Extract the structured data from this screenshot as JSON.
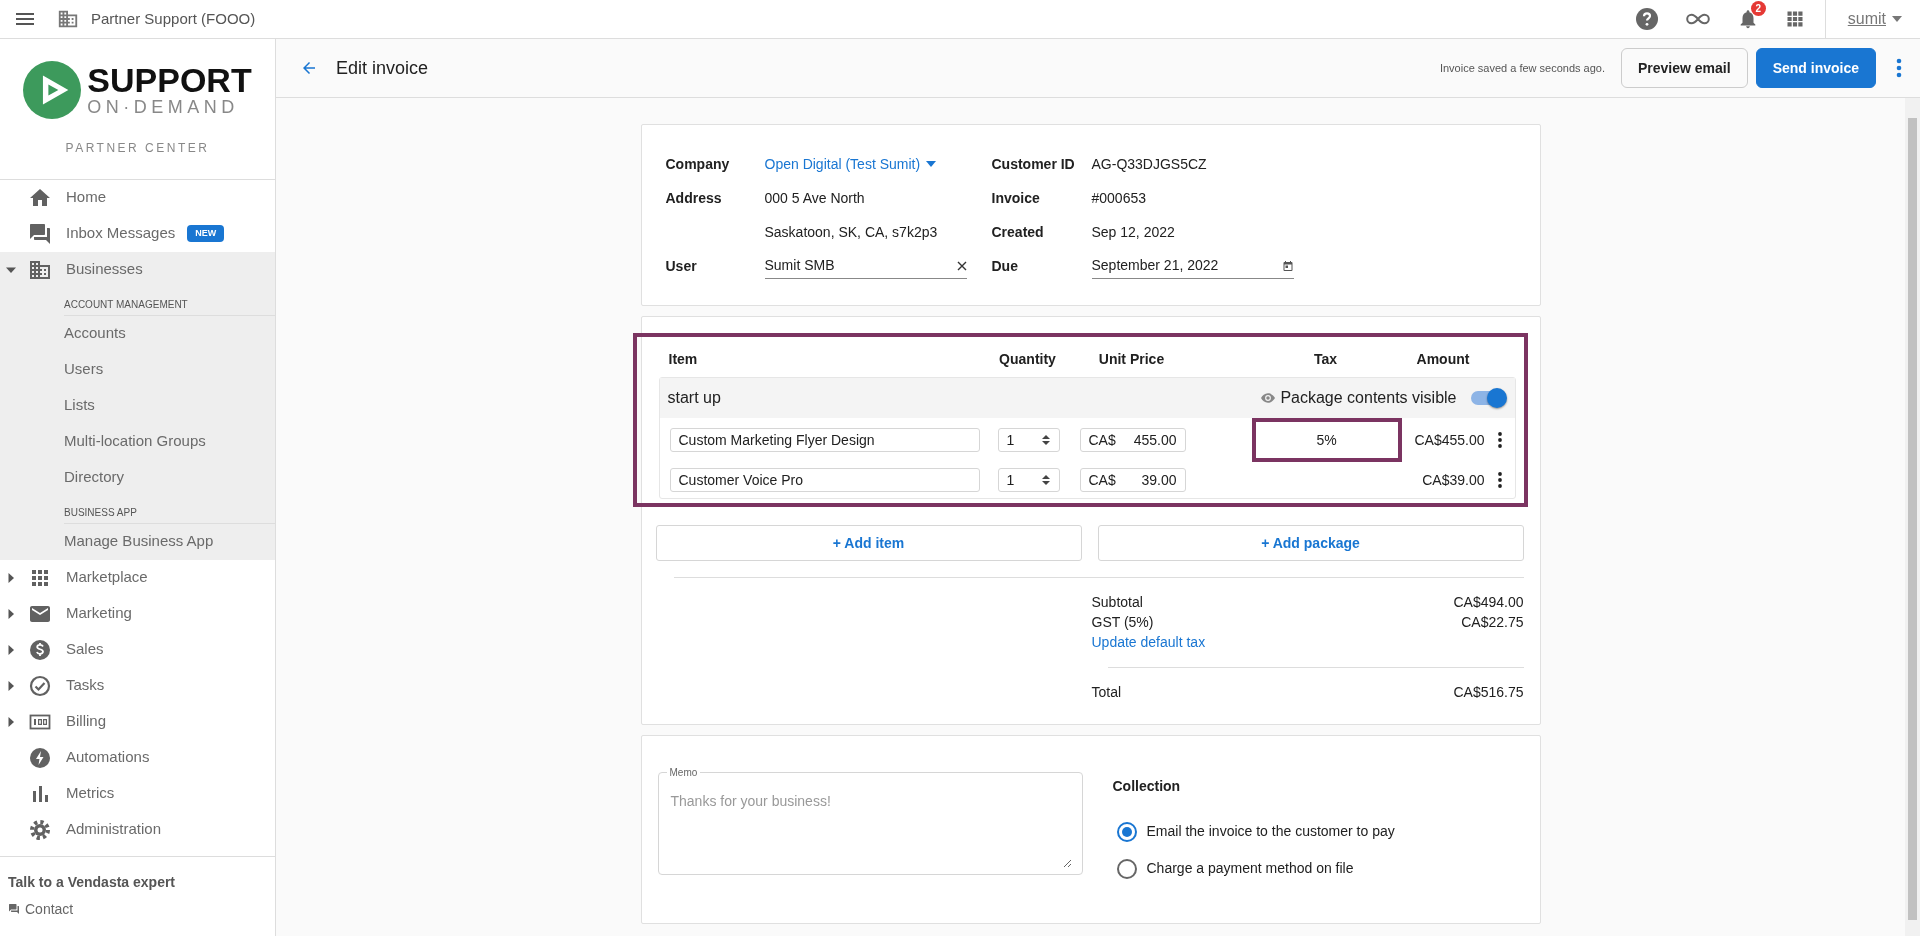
{
  "topbar": {
    "account": "Partner Support (FOOO)",
    "notifications": "2",
    "user": "sumit"
  },
  "brand": {
    "name": "SUPPORT",
    "tagline": "ON·DEMAND",
    "subtitle": "PARTNER CENTER"
  },
  "nav": [
    {
      "label": "Home"
    },
    {
      "label": "Inbox Messages",
      "badge": "NEW"
    },
    {
      "label": "Businesses",
      "expanded": true,
      "sections": [
        {
          "heading": "ACCOUNT MANAGEMENT",
          "items": [
            "Accounts",
            "Users",
            "Lists",
            "Multi-location Groups",
            "Directory"
          ]
        },
        {
          "heading": "BUSINESS APP",
          "items": [
            "Manage Business App"
          ]
        }
      ]
    },
    {
      "label": "Marketplace",
      "expanded": false
    },
    {
      "label": "Marketing",
      "expanded": false
    },
    {
      "label": "Sales",
      "expanded": false
    },
    {
      "label": "Tasks",
      "expanded": false
    },
    {
      "label": "Billing",
      "expanded": false
    },
    {
      "label": "Automations"
    },
    {
      "label": "Metrics"
    },
    {
      "label": "Administration"
    }
  ],
  "help": {
    "title": "Talk to a Vendasta expert",
    "link": "Contact"
  },
  "header": {
    "title": "Edit invoice",
    "status": "Invoice saved a few seconds ago.",
    "buttons": [
      {
        "label": "Preview email",
        "kind": "secondary"
      },
      {
        "label": "Send invoice",
        "kind": "primary"
      }
    ]
  },
  "details": {
    "rows": [
      [
        {
          "label": "Company",
          "value": "Open Digital (Test Sumit)",
          "kind": "dropdown"
        },
        {
          "label": "Customer ID",
          "value": "AG-Q33DJGS5CZ",
          "kind": "text"
        }
      ],
      [
        {
          "label": "Address",
          "value": "000 5 Ave North",
          "kind": "text"
        },
        {
          "label": "Invoice",
          "value": "#000653",
          "kind": "text"
        }
      ],
      [
        {
          "value": "Saskatoon, SK, CA, s7k2p3",
          "kind": "text"
        },
        {
          "label": "Created",
          "value": "Sep 12, 2022",
          "kind": "text"
        }
      ],
      [
        {
          "label": "User",
          "value": "Sumit SMB",
          "kind": "clearable"
        },
        {
          "label": "Due",
          "value": "September 21, 2022",
          "kind": "date"
        }
      ]
    ]
  },
  "items": {
    "highlighted": true,
    "columns": [
      "Item",
      "Quantity",
      "Unit Price",
      "Tax",
      "Amount"
    ],
    "package": {
      "name": "start up",
      "visibility_label": "Package contents visible",
      "on": true
    },
    "rows": [
      {
        "name": "Custom Marketing Flyer Design",
        "quantity": "1",
        "currency": "CA$",
        "price": "455.00",
        "tax": "5%",
        "tax_highlighted": true,
        "amount": "CA$455.00"
      },
      {
        "name": "Customer Voice Pro",
        "quantity": "1",
        "currency": "CA$",
        "price": "39.00",
        "tax_highlighted": false,
        "amount": "CA$39.00"
      }
    ],
    "add_buttons": [
      "+ Add item",
      "+ Add package"
    ]
  },
  "totals": {
    "lines": [
      {
        "label": "Subtotal",
        "value": "CA$494.00"
      },
      {
        "label": "GST (5%)",
        "value": "CA$22.75"
      }
    ],
    "link": "Update default tax",
    "total": {
      "label": "Total",
      "value": "CA$516.75"
    }
  },
  "memo": {
    "label": "Memo",
    "placeholder": "Thanks for your business!"
  },
  "collection": {
    "title": "Collection",
    "options": [
      {
        "label": "Email the invoice to the customer to pay",
        "selected": true
      },
      {
        "label": "Charge a payment method on file",
        "selected": false
      }
    ]
  }
}
